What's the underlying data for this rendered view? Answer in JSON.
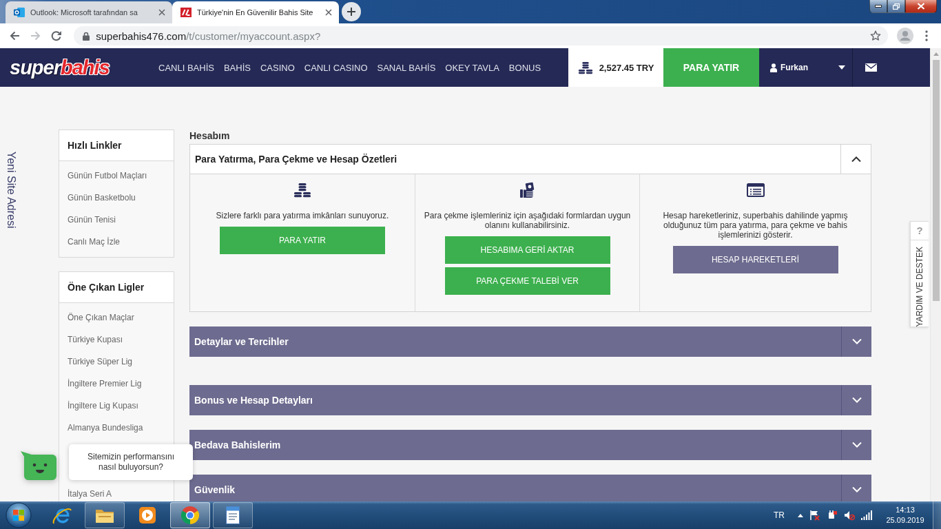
{
  "browser": {
    "tabs": [
      {
        "kind": "mail",
        "title": "Outlook: Microsoft tarafından sa",
        "selected": false
      },
      {
        "kind": "site",
        "title": "Türkiye'nin En Güvenilir Bahis Site",
        "selected": true
      }
    ],
    "nav_buttons": [
      {
        "kind": "back",
        "disabled": false
      },
      {
        "kind": "forward",
        "disabled": true
      },
      {
        "kind": "reload",
        "disabled": false
      }
    ],
    "address": {
      "host": "superbahis476.com",
      "path": "/t/customer/myaccount.aspx?"
    }
  },
  "header": {
    "logo": {
      "first": "super",
      "second": "bahis"
    },
    "nav": [
      "CANLI BAHİS",
      "BAHİS",
      "CASINO",
      "CANLI CASINO",
      "SANAL BAHİS",
      "OKEY TAVLA",
      "BONUS"
    ],
    "balance": "2,527.45 TRY",
    "deposit_button": "PARA YATIR",
    "user": "Furkan"
  },
  "side_link": "Yeni Site Adresi",
  "sidebar": [
    {
      "title": "Hızlı Linkler",
      "items": [
        "Günün Futbol Maçları",
        "Günün Basketbolu",
        "Günün Tenisi",
        "Canlı Maç İzle"
      ]
    },
    {
      "title": "Öne Çıkan Ligler",
      "items": [
        "Öne Çıkan Maçlar",
        "Türkiye Kupası",
        "Türkiye Süper Lig",
        "İngiltere Premier Lig",
        "İngiltere Lig Kupası",
        "Almanya Bundesliga",
        "İtalya Seri A"
      ]
    }
  ],
  "main": {
    "title": "Hesabım",
    "panels": [
      {
        "title": "Para Yatırma, Para Çekme ve Hesap Özetleri",
        "expanded": true,
        "columns": [
          {
            "kind": "deposit",
            "text": "Sizlere farklı para yatırma imkânları sunuyoruz.",
            "buttons": [
              {
                "kind": "primary",
                "label": "PARA YATIR"
              }
            ]
          },
          {
            "kind": "withdraw",
            "text": "Para çekme işlemleriniz için aşağıdaki formlardan uygun olanını kullanabilirsiniz.",
            "buttons": [
              {
                "kind": "primary",
                "label": "HESABIMA GERİ AKTAR"
              },
              {
                "kind": "primary",
                "label": "PARA ÇEKME TALEBİ VER"
              }
            ]
          },
          {
            "kind": "history",
            "text": "Hesap hareketleriniz, superbahis dahilinde yapmış olduğunuz tüm para yatırma, para çekme ve bahis işlemlerinizi gösterir.",
            "buttons": [
              {
                "kind": "secondary",
                "label": "HESAP HAREKETLERİ"
              }
            ]
          }
        ]
      },
      {
        "title": "Detaylar ve Tercihler",
        "expanded": false
      },
      {
        "title": "Bonus ve Hesap Detayları",
        "expanded": false
      },
      {
        "title": "Bedava Bahislerim",
        "expanded": false
      },
      {
        "title": "Güvenlik",
        "expanded": false
      }
    ]
  },
  "help_tab": {
    "icon_text": "?",
    "label": "YARDIM VE DESTEK"
  },
  "chat": {
    "prompt": "Sitemizin performansını nasıl buluyorsun?"
  },
  "taskbar": {
    "apps": [
      {
        "kind": "ie",
        "running": false,
        "selected": false
      },
      {
        "kind": "files",
        "running": true,
        "selected": false
      },
      {
        "kind": "media",
        "running": false,
        "selected": false
      },
      {
        "kind": "chrome",
        "running": true,
        "selected": true
      },
      {
        "kind": "writer",
        "running": true,
        "selected": false
      }
    ],
    "language": "TR",
    "time": "14:13",
    "date": "25.09.2019"
  }
}
